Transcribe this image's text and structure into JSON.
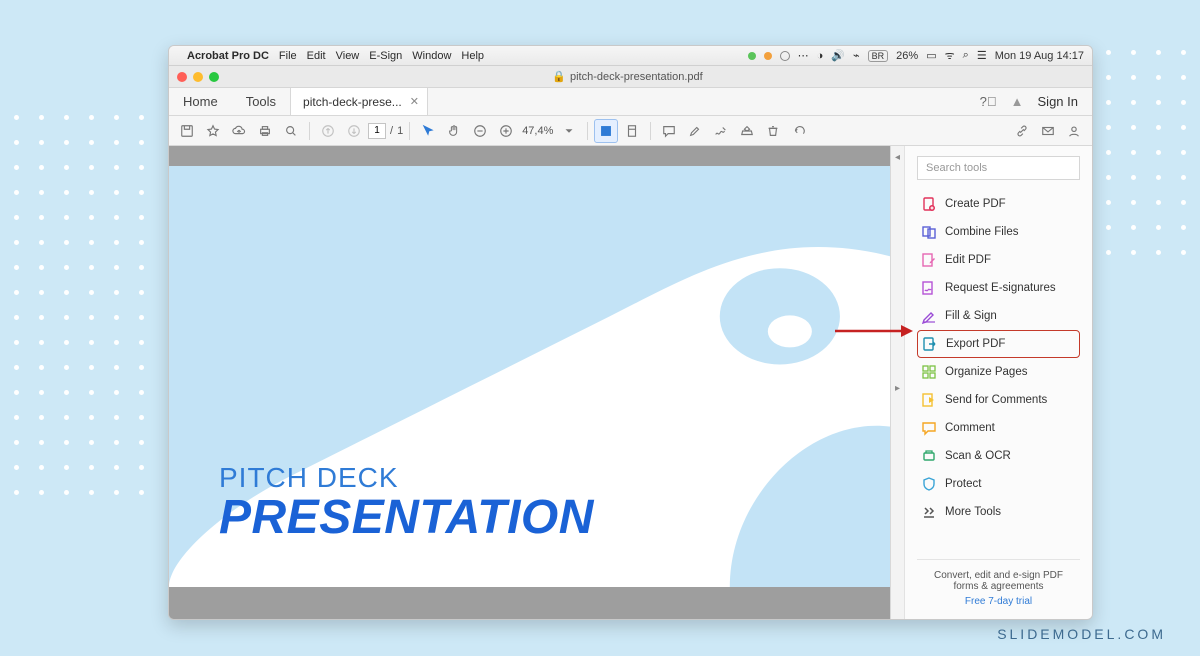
{
  "menubar": {
    "appname": "Acrobat Pro DC",
    "items": [
      "File",
      "Edit",
      "View",
      "E-Sign",
      "Window",
      "Help"
    ],
    "status": {
      "br": "BR",
      "battery": "26%",
      "datetime": "Mon 19 Aug  14:17"
    }
  },
  "window": {
    "title": "pitch-deck-presentation.pdf"
  },
  "tabs": {
    "home": "Home",
    "tools": "Tools",
    "doc": "pitch-deck-prese...",
    "signin": "Sign In"
  },
  "toolbar": {
    "page_current": "1",
    "page_total": "1",
    "zoom": "47,4%"
  },
  "doc": {
    "line1": "PITCH DECK",
    "line2": "PRESENTATION"
  },
  "tools_panel": {
    "search_placeholder": "Search tools",
    "items": [
      {
        "label": "Create PDF",
        "color": "#e1325b"
      },
      {
        "label": "Combine Files",
        "color": "#5a5fd6"
      },
      {
        "label": "Edit PDF",
        "color": "#e667b3"
      },
      {
        "label": "Request E-signatures",
        "color": "#b553d6"
      },
      {
        "label": "Fill & Sign",
        "color": "#9a4bd6"
      },
      {
        "label": "Export PDF",
        "color": "#1f8fb0",
        "highlight": true
      },
      {
        "label": "Organize Pages",
        "color": "#7cc243"
      },
      {
        "label": "Send for Comments",
        "color": "#f5c132"
      },
      {
        "label": "Comment",
        "color": "#f5a623"
      },
      {
        "label": "Scan & OCR",
        "color": "#2fa86c"
      },
      {
        "label": "Protect",
        "color": "#3aa4d6"
      },
      {
        "label": "More Tools",
        "color": "#555555"
      }
    ],
    "footer_line": "Convert, edit and e-sign PDF forms & agreements",
    "footer_trial": "Free 7-day trial"
  },
  "watermark": "SLIDEMODEL.COM"
}
